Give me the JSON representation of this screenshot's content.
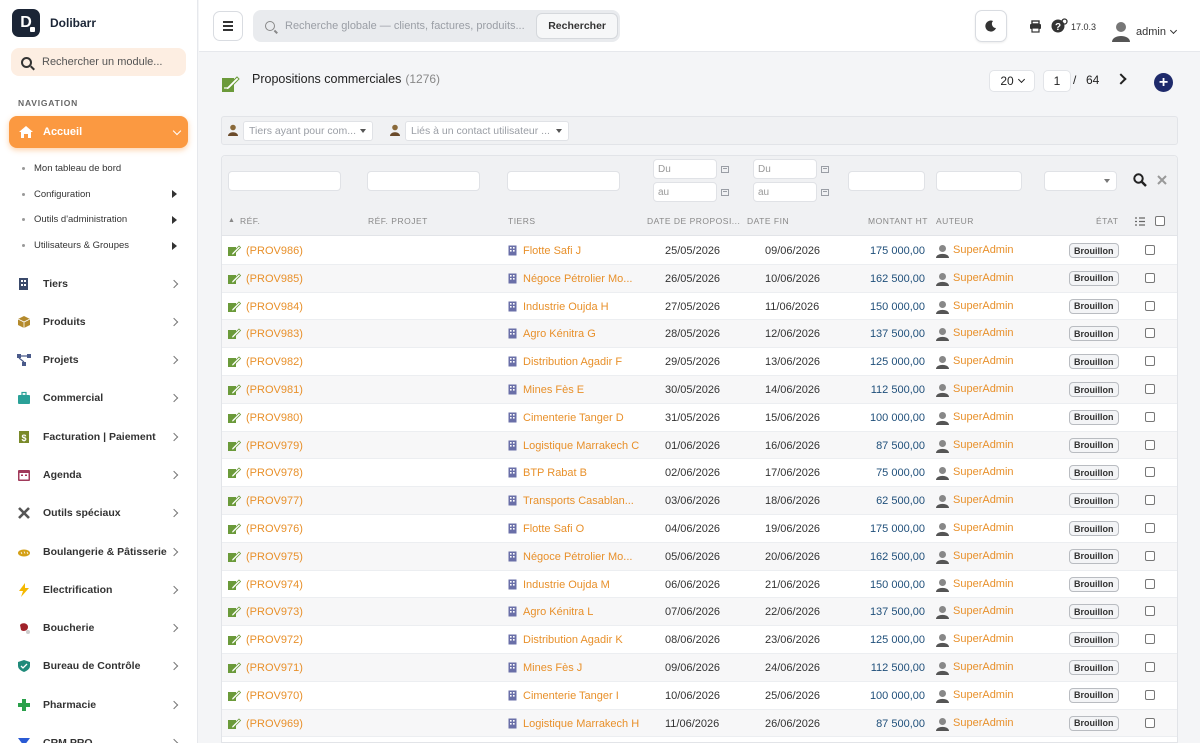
{
  "app": {
    "name": "Dolibarr",
    "logo_letter": "D"
  },
  "sidebar": {
    "search_placeholder": "Rechercher un module...",
    "nav_heading": "NAVIGATION",
    "active_item": "Accueil",
    "subitems": [
      {
        "label": "Mon tableau de bord",
        "arrow": false
      },
      {
        "label": "Configuration",
        "arrow": true
      },
      {
        "label": "Outils d'administration",
        "arrow": true
      },
      {
        "label": "Utilisateurs & Groupes",
        "arrow": true
      }
    ],
    "items": [
      {
        "label": "Tiers",
        "icon": "building-icon",
        "color": "#3a4a6b"
      },
      {
        "label": "Produits",
        "icon": "cube-icon",
        "color": "#b48a2c"
      },
      {
        "label": "Projets",
        "icon": "sitemap-icon",
        "color": "#4a5a8a"
      },
      {
        "label": "Commercial",
        "icon": "briefcase-icon",
        "color": "#2aa198"
      },
      {
        "label": "Facturation | Paiement",
        "icon": "invoice-icon",
        "color": "#7a8a2a"
      },
      {
        "label": "Agenda",
        "icon": "calendar-icon",
        "color": "#a03a5a"
      },
      {
        "label": "Outils spéciaux",
        "icon": "tools-icon",
        "color": "#555555"
      },
      {
        "label": "Boulangerie & Pâtisserie",
        "icon": "bread-icon",
        "color": "#d4a017"
      },
      {
        "label": "Electrification",
        "icon": "bolt-icon",
        "color": "#f5b800"
      },
      {
        "label": "Boucherie",
        "icon": "meat-icon",
        "color": "#a0222a"
      },
      {
        "label": "Bureau de Contrôle",
        "icon": "shield-icon",
        "color": "#1f8a7a"
      },
      {
        "label": "Pharmacie",
        "icon": "cross-icon",
        "color": "#2aa04a"
      },
      {
        "label": "CRM PRO",
        "icon": "funnel-icon",
        "color": "#2a5ad4"
      }
    ]
  },
  "topbar": {
    "search_placeholder": "Recherche globale — clients, factures, produits...",
    "search_button": "Rechercher",
    "version": "17.0.3",
    "user": "admin"
  },
  "page": {
    "title": "Propositions commerciales",
    "count": "(1276)",
    "limit": "20",
    "current_page": "1",
    "separator": "/",
    "total_pages": "64"
  },
  "filters": {
    "tiers_placeholder": "Tiers ayant pour com...",
    "contact_placeholder": "Liés à un contact utilisateur ...",
    "date_from": "Du",
    "date_to": "au"
  },
  "columns": [
    "RÉF.",
    "RÉF. PROJET",
    "TIERS",
    "DATE DE PROPOSI...",
    "DATE FIN",
    "MONTANT HT",
    "AUTEUR",
    "ÉTAT"
  ],
  "rows": [
    {
      "ref": "(PROV986)",
      "tiers": "Flotte Safi J",
      "date": "25/05/2026",
      "end": "09/06/2026",
      "amount": "175 000,00",
      "author": "SuperAdmin",
      "status": "Brouillon"
    },
    {
      "ref": "(PROV985)",
      "tiers": "Négoce Pétrolier Mo...",
      "date": "26/05/2026",
      "end": "10/06/2026",
      "amount": "162 500,00",
      "author": "SuperAdmin",
      "status": "Brouillon"
    },
    {
      "ref": "(PROV984)",
      "tiers": "Industrie Oujda H",
      "date": "27/05/2026",
      "end": "11/06/2026",
      "amount": "150 000,00",
      "author": "SuperAdmin",
      "status": "Brouillon"
    },
    {
      "ref": "(PROV983)",
      "tiers": "Agro Kénitra G",
      "date": "28/05/2026",
      "end": "12/06/2026",
      "amount": "137 500,00",
      "author": "SuperAdmin",
      "status": "Brouillon"
    },
    {
      "ref": "(PROV982)",
      "tiers": "Distribution Agadir F",
      "date": "29/05/2026",
      "end": "13/06/2026",
      "amount": "125 000,00",
      "author": "SuperAdmin",
      "status": "Brouillon"
    },
    {
      "ref": "(PROV981)",
      "tiers": "Mines Fès E",
      "date": "30/05/2026",
      "end": "14/06/2026",
      "amount": "112 500,00",
      "author": "SuperAdmin",
      "status": "Brouillon"
    },
    {
      "ref": "(PROV980)",
      "tiers": "Cimenterie Tanger D",
      "date": "31/05/2026",
      "end": "15/06/2026",
      "amount": "100 000,00",
      "author": "SuperAdmin",
      "status": "Brouillon"
    },
    {
      "ref": "(PROV979)",
      "tiers": "Logistique Marrakech C",
      "date": "01/06/2026",
      "end": "16/06/2026",
      "amount": "87 500,00",
      "author": "SuperAdmin",
      "status": "Brouillon"
    },
    {
      "ref": "(PROV978)",
      "tiers": "BTP Rabat B",
      "date": "02/06/2026",
      "end": "17/06/2026",
      "amount": "75 000,00",
      "author": "SuperAdmin",
      "status": "Brouillon"
    },
    {
      "ref": "(PROV977)",
      "tiers": "Transports Casablan...",
      "date": "03/06/2026",
      "end": "18/06/2026",
      "amount": "62 500,00",
      "author": "SuperAdmin",
      "status": "Brouillon"
    },
    {
      "ref": "(PROV976)",
      "tiers": "Flotte Safi O",
      "date": "04/06/2026",
      "end": "19/06/2026",
      "amount": "175 000,00",
      "author": "SuperAdmin",
      "status": "Brouillon"
    },
    {
      "ref": "(PROV975)",
      "tiers": "Négoce Pétrolier Mo...",
      "date": "05/06/2026",
      "end": "20/06/2026",
      "amount": "162 500,00",
      "author": "SuperAdmin",
      "status": "Brouillon"
    },
    {
      "ref": "(PROV974)",
      "tiers": "Industrie Oujda M",
      "date": "06/06/2026",
      "end": "21/06/2026",
      "amount": "150 000,00",
      "author": "SuperAdmin",
      "status": "Brouillon"
    },
    {
      "ref": "(PROV973)",
      "tiers": "Agro Kénitra L",
      "date": "07/06/2026",
      "end": "22/06/2026",
      "amount": "137 500,00",
      "author": "SuperAdmin",
      "status": "Brouillon"
    },
    {
      "ref": "(PROV972)",
      "tiers": "Distribution Agadir K",
      "date": "08/06/2026",
      "end": "23/06/2026",
      "amount": "125 000,00",
      "author": "SuperAdmin",
      "status": "Brouillon"
    },
    {
      "ref": "(PROV971)",
      "tiers": "Mines Fès J",
      "date": "09/06/2026",
      "end": "24/06/2026",
      "amount": "112 500,00",
      "author": "SuperAdmin",
      "status": "Brouillon"
    },
    {
      "ref": "(PROV970)",
      "tiers": "Cimenterie Tanger I",
      "date": "10/06/2026",
      "end": "25/06/2026",
      "amount": "100 000,00",
      "author": "SuperAdmin",
      "status": "Brouillon"
    },
    {
      "ref": "(PROV969)",
      "tiers": "Logistique Marrakech H",
      "date": "11/06/2026",
      "end": "26/06/2026",
      "amount": "87 500,00",
      "author": "SuperAdmin",
      "status": "Brouillon"
    }
  ]
}
